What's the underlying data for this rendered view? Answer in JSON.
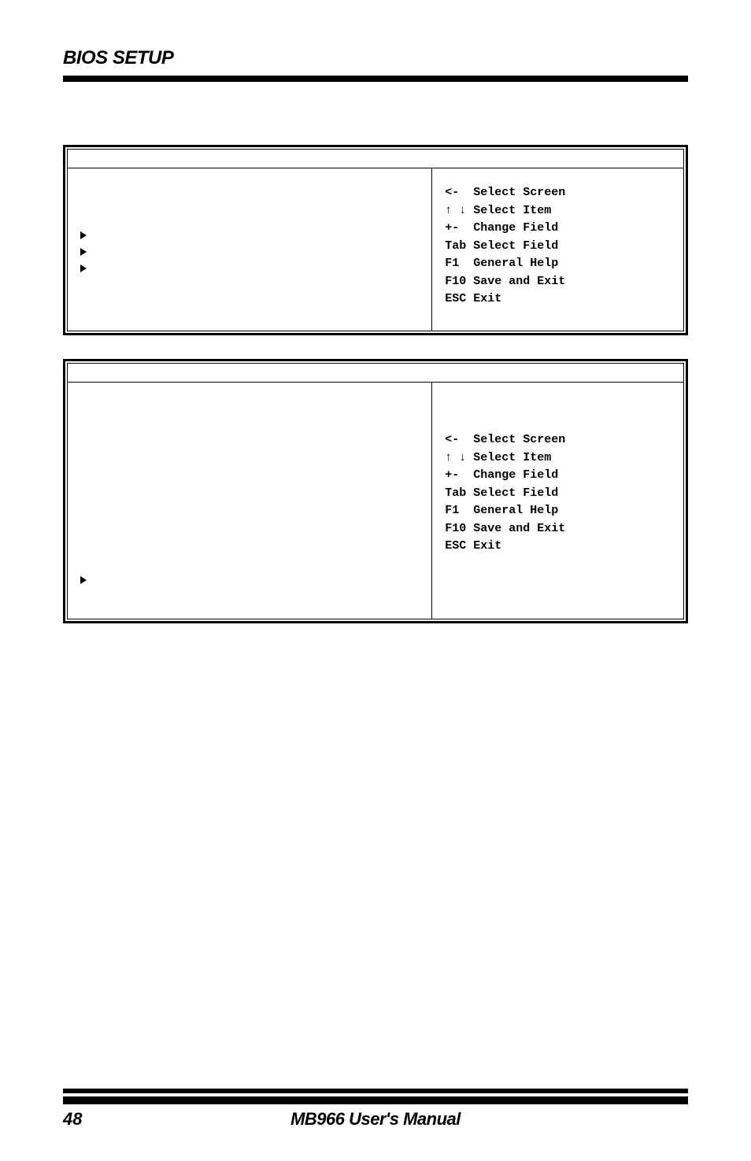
{
  "header": {
    "title": "BIOS SETUP"
  },
  "help": {
    "line1": "<-  Select Screen",
    "line2_prefix": "",
    "line2_arrows": "↑ ↓",
    "line2_suffix": " Select Item",
    "line3": "+-  Change Field",
    "line4": "Tab Select Field",
    "line5": "F1  General Help",
    "line6": "F10 Save and Exit",
    "line7": "ESC Exit"
  },
  "footer": {
    "page": "48",
    "title": "MB966 User's Manual"
  }
}
